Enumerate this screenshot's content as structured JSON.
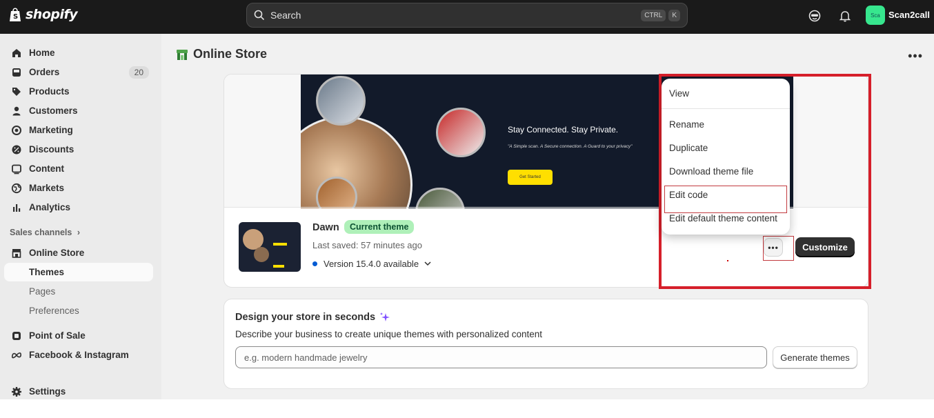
{
  "topbar": {
    "brand": "shopify",
    "search_label": "Search",
    "shortcut_ctrl": "CTRL",
    "shortcut_k": "K",
    "avatar_initials": "Sca",
    "store_name": "Scan2call"
  },
  "sidebar": {
    "home": "Home",
    "orders": "Orders",
    "orders_count": "20",
    "products": "Products",
    "customers": "Customers",
    "marketing": "Marketing",
    "discounts": "Discounts",
    "content": "Content",
    "markets": "Markets",
    "analytics": "Analytics",
    "sales_channels": "Sales channels",
    "online_store": "Online Store",
    "themes": "Themes",
    "pages": "Pages",
    "preferences": "Preferences",
    "point_of_sale": "Point of Sale",
    "facebook_instagram": "Facebook & Instagram",
    "settings": "Settings"
  },
  "page": {
    "title": "Online Store"
  },
  "theme_preview": {
    "headline": "Stay Connected. Stay Private.",
    "subline": "\"A Simple scan. A Secure connection. A Guard to your privacy\"",
    "cta": "Get Started"
  },
  "theme": {
    "name": "Dawn",
    "badge": "Current theme",
    "last_saved": "Last saved: 57 minutes ago",
    "version": "Version 15.4.0 available",
    "more_label": "•••",
    "customize": "Customize"
  },
  "theme_menu": {
    "items": [
      "View",
      "Rename",
      "Duplicate",
      "Download theme file",
      "Edit code",
      "Edit default theme content"
    ]
  },
  "design": {
    "title": "Design your store in seconds",
    "description": "Describe your business to create unique themes with personalized content",
    "input_placeholder": "e.g. modern handmade jewelry",
    "input_value": "",
    "generate": "Generate themes"
  },
  "colors": {
    "topbar": "#1a1a1a",
    "highlight_red": "#d61f2a",
    "badge_green": "#aff0b9",
    "version_dot": "#005bd3"
  }
}
